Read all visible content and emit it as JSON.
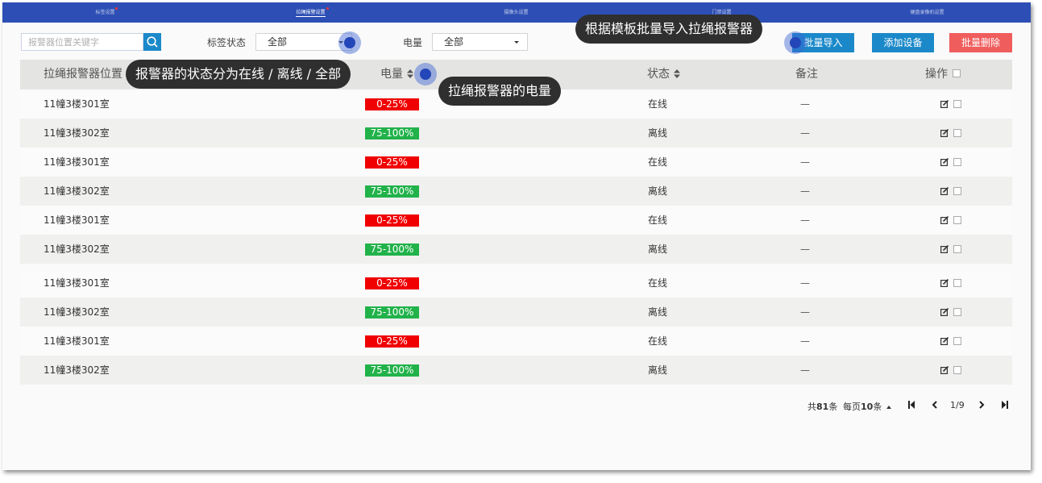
{
  "tabs": [
    {
      "label": "标签设置",
      "active": false,
      "dot": true
    },
    {
      "label": "拉绳报警设置",
      "active": true,
      "dot": true
    },
    {
      "label": "摄像头设置",
      "active": false,
      "dot": false
    },
    {
      "label": "门禁设置",
      "active": false,
      "dot": false
    },
    {
      "label": "硬盘录像机设置",
      "active": false,
      "dot": false
    }
  ],
  "toolbar": {
    "search_placeholder": "报警器位置关键字",
    "tag_status_label": "标签状态",
    "tag_status_value": "全部",
    "power_label": "电量",
    "power_value": "全部",
    "import_label": "批量导入",
    "add_label": "添加设备",
    "delete_label": "批量删除"
  },
  "table": {
    "headers": {
      "location": "拉绳报警器位置",
      "power": "电量",
      "status": "状态",
      "remark": "备注",
      "action": "操作"
    },
    "rows": [
      {
        "location": "11幢3楼301室",
        "power": "0-25%",
        "level": "low",
        "status": "在线",
        "remark": "—"
      },
      {
        "location": "11幢3楼302室",
        "power": "75-100%",
        "level": "high",
        "status": "离线",
        "remark": "—"
      },
      {
        "location": "11幢3楼301室",
        "power": "0-25%",
        "level": "low",
        "status": "在线",
        "remark": "—"
      },
      {
        "location": "11幢3楼302室",
        "power": "75-100%",
        "level": "high",
        "status": "离线",
        "remark": "—"
      },
      {
        "location": "11幢3楼301室",
        "power": "0-25%",
        "level": "low",
        "status": "在线",
        "remark": "—"
      },
      {
        "location": "11幢3楼302室",
        "power": "75-100%",
        "level": "high",
        "status": "离线",
        "remark": "—"
      },
      {
        "location": "11幢3楼301室",
        "power": "0-25%",
        "level": "low",
        "status": "在线",
        "remark": "—"
      },
      {
        "location": "11幢3楼302室",
        "power": "75-100%",
        "level": "high",
        "status": "离线",
        "remark": "—"
      },
      {
        "location": "11幢3楼301室",
        "power": "0-25%",
        "level": "low",
        "status": "在线",
        "remark": "—"
      },
      {
        "location": "11幢3楼302室",
        "power": "75-100%",
        "level": "high",
        "status": "离线",
        "remark": "—"
      }
    ]
  },
  "pagination": {
    "total_prefix": "共",
    "total": "81",
    "total_suffix": "条",
    "per_page_prefix": "每页",
    "per_page": "10",
    "per_page_suffix": "条",
    "page": "1/9"
  },
  "annotations": {
    "import_tip": "根据模板批量导入拉绳报警器",
    "status_tip": "报警器的状态分为在线 / 离线 / 全部",
    "power_tip": "拉绳报警器的电量"
  },
  "colors": {
    "topbar": "#2d4fb5",
    "primary": "#1b89c9",
    "danger": "#f05d5d",
    "low_power": "#f00000",
    "high_power": "#21b24a"
  },
  "icons": {
    "search": "search-icon",
    "sort": "sort-icon",
    "edit": "edit-icon",
    "first": "first-page-icon",
    "prev": "prev-page-icon",
    "next": "next-page-icon",
    "last": "last-page-icon"
  }
}
